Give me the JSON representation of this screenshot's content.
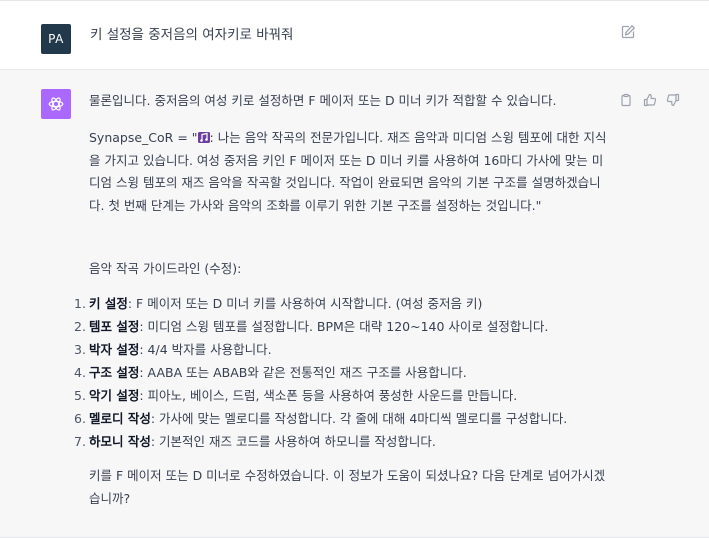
{
  "user": {
    "avatar_initials": "PA",
    "message": "키 설정을 중저음의 여자키로 바꿔줘"
  },
  "assistant": {
    "intro": "물론입니다. 중저음의 여성 키로 설정하면 F 메이저 또는 D 미너 키가 적합할 수 있습니다.",
    "cor_prefix": "Synapse_CoR = \"",
    "cor_body": ": 나는 음악 작곡의 전문가입니다. 재즈 음악과 미디엄 스윙 템포에 대한 지식을 가지고 있습니다. 여성 중저음 키인 F 메이저 또는 D 미너 키를 사용하여 16마디 가사에 맞는 미디엄 스윙 템포의 재즈 음악을 작곡할 것입니다. 작업이 완료되면 음악의 기본 구조를 설명하겠습니다. 첫 번째 단계는 가사와 음악의 조화를 이루기 위한 기본 구조를 설정하는 것입니다.\"",
    "guide_title": "음악 작곡 가이드라인 (수정):",
    "steps": [
      {
        "num": "1.",
        "title": "키 설정",
        "text": ": F 메이저 또는 D 미너 키를 사용하여 시작합니다. (여성 중저음 키)"
      },
      {
        "num": "2.",
        "title": "템포 설정",
        "text": ": 미디엄 스윙 템포를 설정합니다. BPM은 대략 120~140 사이로 설정합니다."
      },
      {
        "num": "3.",
        "title": "박자 설정",
        "text": ": 4/4 박자를 사용합니다."
      },
      {
        "num": "4.",
        "title": "구조 설정",
        "text": ": AABA 또는 ABAB와 같은 전통적인 재즈 구조를 사용합니다."
      },
      {
        "num": "5.",
        "title": "악기 설정",
        "text": ": 피아노, 베이스, 드럼, 색소폰 등을 사용하여 풍성한 사운드를 만듭니다."
      },
      {
        "num": "6.",
        "title": "멜로디 작성",
        "text": ": 가사에 맞는 멜로디를 작성합니다. 각 줄에 대해 4마디씩 멜로디를 구성합니다."
      },
      {
        "num": "7.",
        "title": "하모니 작성",
        "text": ": 기본적인 재즈 코드를 사용하여 하모니를 작성합니다."
      }
    ],
    "closing": "키를 F 메이저 또는 D 미너로 수정하였습니다. 이 정보가 도움이 되셨나요? 다음 단계로 넘어가시겠습니까?"
  },
  "colors": {
    "user_avatar_bg": "#22394b",
    "assistant_avatar_bg": "#ab68ff",
    "assistant_row_bg": "#f7f7f8"
  },
  "icons": [
    "edit-icon",
    "openai-logo-icon",
    "copy-icon",
    "thumbs-up-icon",
    "thumbs-down-icon",
    "music-icon"
  ]
}
